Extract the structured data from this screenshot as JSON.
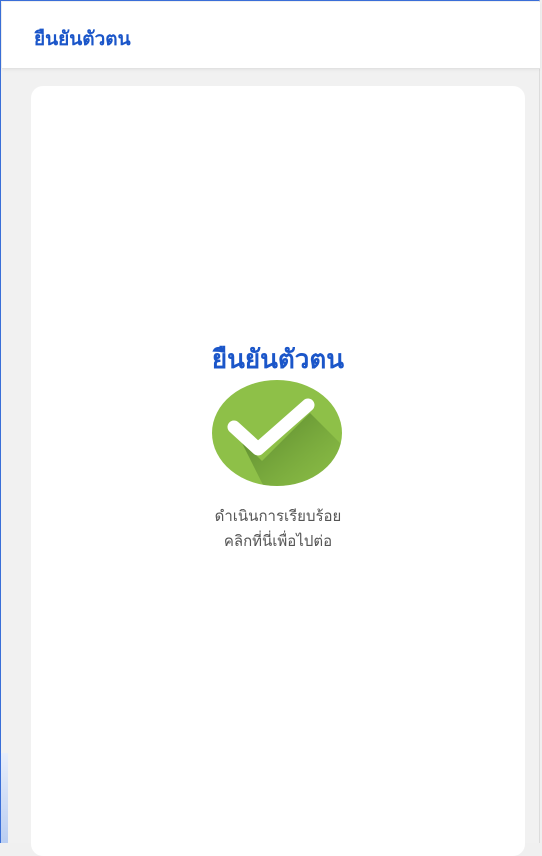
{
  "header": {
    "title": "ยืนยันตัวตน"
  },
  "card": {
    "title": "ยืนยันตัวตน",
    "icon": "check-circle-icon",
    "message_line1": "ดำเนินการเรียบร้อย",
    "message_line2": "คลิกที่นี่เพื่อไปต่อ"
  },
  "colors": {
    "accent_blue": "#1b56c9",
    "success_green": "#8ec048",
    "text_gray": "#555555",
    "page_bg": "#f1f1f1"
  }
}
